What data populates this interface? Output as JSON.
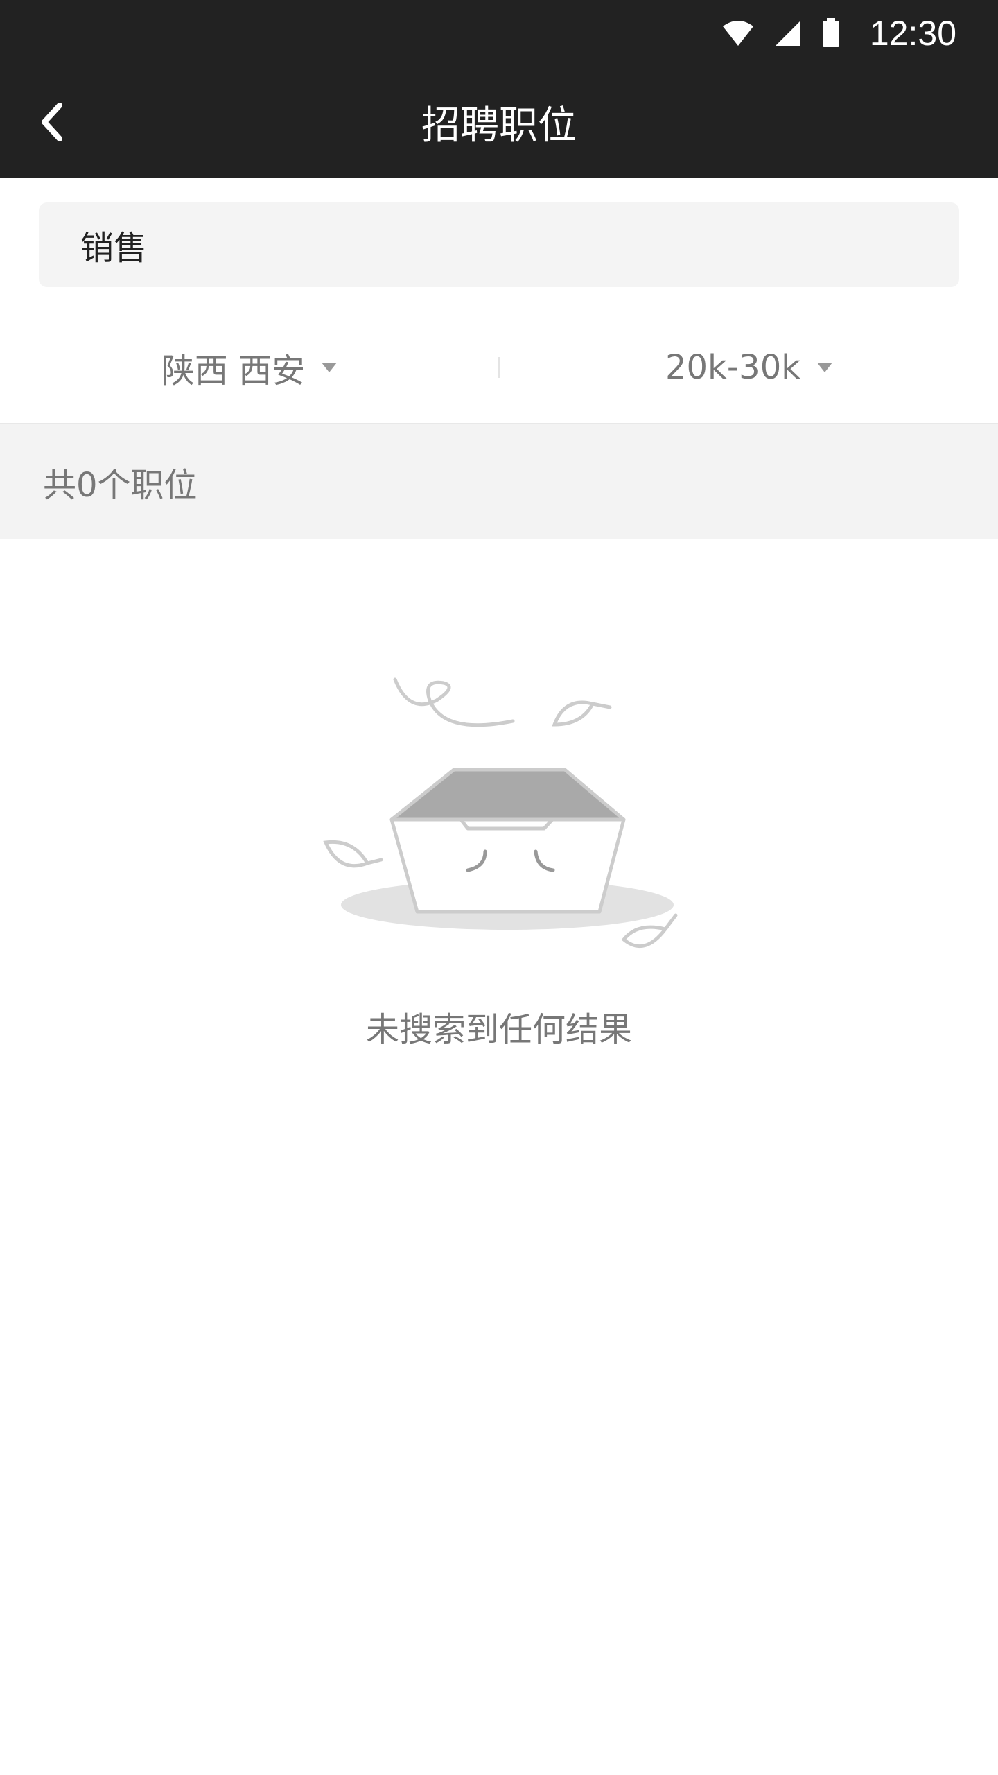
{
  "status_bar": {
    "time": "12:30",
    "icons": [
      "wifi-icon",
      "signal-icon",
      "battery-icon"
    ]
  },
  "nav": {
    "title": "招聘职位",
    "back_icon": "chevron-left-icon"
  },
  "search": {
    "value": "销售"
  },
  "filters": {
    "location": "陕西 西安",
    "salary": "20k-30k"
  },
  "results": {
    "count_text": "共0个职位",
    "empty_text": "未搜索到任何结果"
  },
  "colors": {
    "header_bg": "#222222",
    "muted_text": "#777777",
    "panel_bg": "#f3f3f3"
  }
}
